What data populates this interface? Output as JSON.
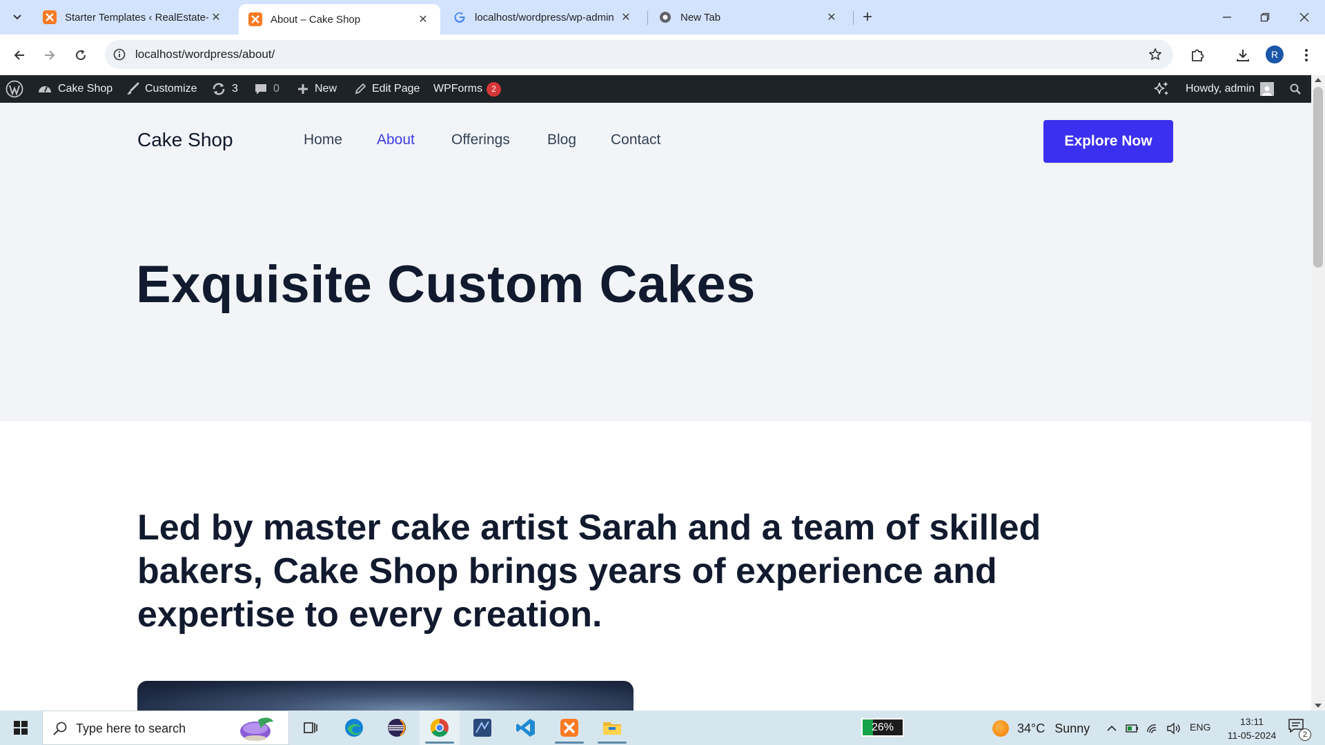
{
  "browser": {
    "tabs": [
      {
        "title": "Starter Templates ‹ RealEstate-E",
        "close": "✕"
      },
      {
        "title": "About – Cake Shop",
        "close": "✕"
      },
      {
        "title": "localhost/wordpress/wp-admin",
        "close": "✕"
      },
      {
        "title": "New Tab",
        "close": "✕"
      }
    ],
    "new_tab": "+",
    "url": "localhost/wordpress/about/",
    "profile_initial": "R"
  },
  "adminbar": {
    "site_name": "Cake Shop",
    "customize": "Customize",
    "updates_count": "3",
    "comments_count": "0",
    "new_label": "New",
    "edit_page": "Edit Page",
    "wpforms": "WPForms",
    "wpforms_badge": "2",
    "howdy": "Howdy, admin"
  },
  "site": {
    "title": "Cake Shop",
    "menu": [
      "Home",
      "About",
      "Offerings",
      "Blog",
      "Contact"
    ],
    "current_menu": "About",
    "cta": "Explore Now",
    "hero_title": "Exquisite Custom Cakes",
    "intro": "Led by master cake artist Sarah and a team of skilled bakers, Cake Shop brings years of experience and expertise to every creation."
  },
  "colors": {
    "accent": "#3b30f0",
    "admin_bar": "#1d2327",
    "hero_bg": "#f2f4f7",
    "heading": "#111a2e",
    "badge": "#d63638"
  },
  "taskbar": {
    "search_placeholder": "Type here to search",
    "battery": "26%",
    "battery_level": 26,
    "temperature": "34°C",
    "condition": "Sunny",
    "language": "ENG",
    "time": "13:11",
    "date": "11-05-2024",
    "notifications": "2",
    "apps": [
      "task-view-icon",
      "edge-icon",
      "eclipse-icon",
      "chrome-icon",
      "app-icon",
      "vscode-icon",
      "xampp-icon",
      "file-explorer-icon"
    ]
  }
}
